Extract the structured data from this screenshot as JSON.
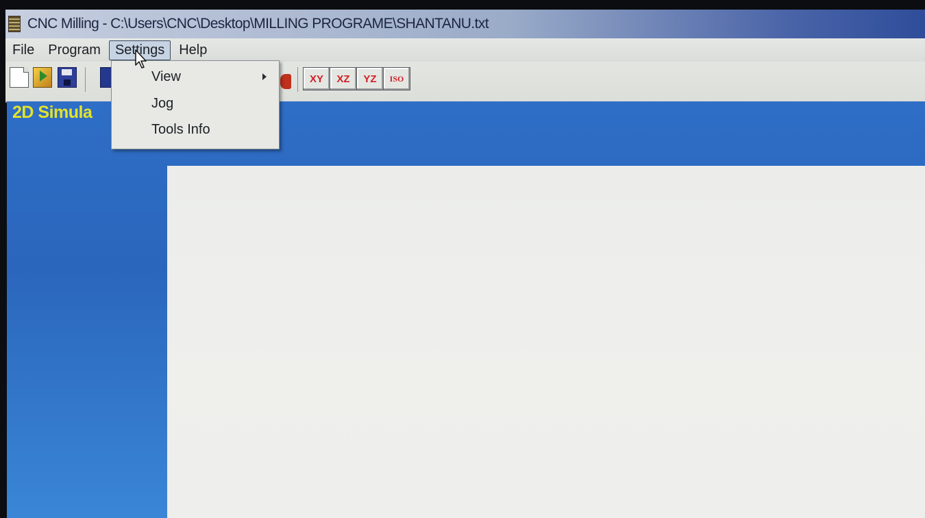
{
  "window": {
    "title": "CNC Milling - C:\\Users\\CNC\\Desktop\\MILLING PROGRAME\\SHANTANU.txt"
  },
  "menubar": {
    "items": [
      {
        "label": "File"
      },
      {
        "label": "Program"
      },
      {
        "label": "Settings",
        "active": true
      },
      {
        "label": "Help"
      }
    ]
  },
  "settings_menu": {
    "items": [
      {
        "label": "View",
        "has_submenu": true
      },
      {
        "label": "Jog"
      },
      {
        "label": "Tools Info"
      }
    ]
  },
  "toolbar": {
    "buttons": [
      {
        "icon": "new-file-icon"
      },
      {
        "icon": "open-folder-icon"
      },
      {
        "icon": "save-disk-icon"
      }
    ],
    "view_buttons": [
      {
        "label": "XY"
      },
      {
        "label": "XZ"
      },
      {
        "label": "YZ"
      },
      {
        "label": "ISO"
      }
    ]
  },
  "panel": {
    "title": "2D Simula"
  },
  "colors": {
    "panel_blue": "#2f6ec6",
    "panel_title": "#e3e32a",
    "view_label_red": "#d01f26"
  }
}
